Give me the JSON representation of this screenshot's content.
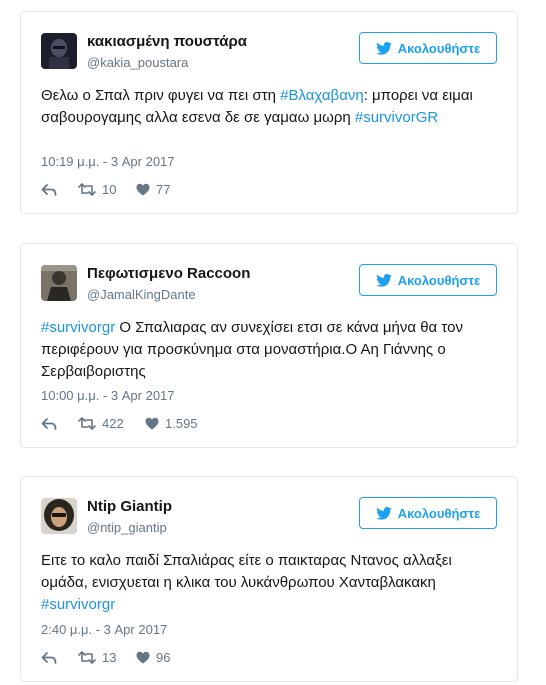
{
  "follow_label": "Ακολουθήστε",
  "tweets": [
    {
      "name": "κακιασμένη πουστάρα",
      "handle": "@kakia_poustara",
      "text_before": "Θελω ο Σπαλ πριν φυγει να πει στη ",
      "hashtag1": "#Βλαχαβανη",
      "text_after": ": μπορει να ειμαι σαβουρογαμης αλλα εσενα δε σε γαμαω μωρη ",
      "hashtag2": "#survivorGR",
      "timestamp": "10:19 μ.μ. - 3 Apr 2017",
      "retweets": "10",
      "likes": "77"
    },
    {
      "name": "Πεφωτισμενο Raccoon",
      "handle": "@JamalKingDante",
      "hashtag1": "#survivorgr",
      "text_after": " Ο Σπαλιαρας αν συνεχίσει ετσι σε κάνα μήνα θα τον περιφέρουν για προσκύνημα στα μοναστήρια.Ο Αη Γιάννης ο Σερβαιβοριστης",
      "timestamp": "10:00 μ.μ. - 3 Apr 2017",
      "retweets": "422",
      "likes": "1.595"
    },
    {
      "name": "Ntip Giantip",
      "handle": "@ntip_giantip",
      "text_before": "Ειτε το καλο παιδί Σπαλιάρας είτε ο παικταρας Ντανος αλλαξει ομάδα, ενισχυεται η κλικα του λυκάνθρωπου Χανταβλακακη ",
      "hashtag2": "#survivorgr",
      "timestamp": "2:40 μ.μ. - 3 Apr 2017",
      "retweets": "13",
      "likes": "96"
    }
  ],
  "colors": {
    "accent": "#1da1f2",
    "hashtag": "#1b95e0",
    "muted": "#657786",
    "border": "#e1e8ed"
  }
}
